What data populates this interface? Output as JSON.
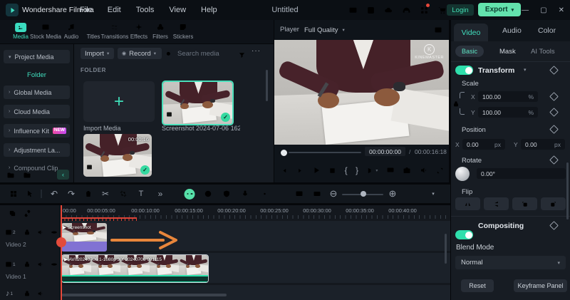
{
  "glyphs": {
    "check": "✓",
    "plus": "+",
    "play": "▶",
    "chevron_down": "▾",
    "chevron_right": "›",
    "chevron_left": "‹",
    "more": "»",
    "ellipsis": "···",
    "undo": "↶",
    "redo": "↷",
    "scissors": "✂",
    "zoom_in_circle": "⊕",
    "zoom_out_circle": "⊖",
    "brace_left": "{",
    "brace_right": "}",
    "minimize": "—",
    "maximize": "▢",
    "close": "✕",
    "record_dot": "◉",
    "text_tool": "T",
    "note": "♪"
  },
  "app": {
    "name": "Wondershare Filmora",
    "menus": [
      "File",
      "Edit",
      "Tools",
      "View",
      "Help"
    ],
    "document_title": "Untitled",
    "login_label": "Login",
    "export_label": "Export"
  },
  "media_tabs": {
    "items": [
      "Media",
      "Stock Media",
      "Audio",
      "Titles",
      "Transitions",
      "Effects",
      "Filters",
      "Stickers"
    ]
  },
  "sidebar": {
    "items": [
      "Project Media",
      "Folder",
      "Global Media",
      "Cloud Media",
      "Influence Kit",
      "Adjustment La...",
      "Compound Clip"
    ],
    "new_badge": "NEW"
  },
  "media_panel": {
    "import_label": "Import",
    "record_label": "Record",
    "search_placeholder": "Search media",
    "section_label": "FOLDER",
    "import_card_label": "Import Media",
    "screenshot_name": "Screenshot 2024-07-06 162...",
    "video_duration": "00:00:16"
  },
  "player": {
    "label": "Player",
    "quality": "Full Quality",
    "watermark_initial": "K",
    "watermark": "KINEMASTER",
    "current_time": "00:00:00:00",
    "time_separator": "/",
    "duration": "00:00:16:18"
  },
  "inspector": {
    "tabs": [
      "Video",
      "Audio",
      "Color"
    ],
    "subtabs": [
      "Basic",
      "Mask",
      "AI Tools"
    ],
    "transform_label": "Transform",
    "scale_label": "Scale",
    "axis_x": "X",
    "axis_y": "Y",
    "scale_x_value": "100.00",
    "scale_y_value": "100.00",
    "percent_unit": "%",
    "position_label": "Position",
    "position_x_value": "0.00",
    "position_y_value": "0.00",
    "px_unit": "px",
    "rotate_label": "Rotate",
    "rotate_value": "0.00°",
    "flip_label": "Flip",
    "compositing_label": "Compositing",
    "blend_mode_label": "Blend Mode",
    "blend_mode_value": "Normal",
    "reset_label": "Reset",
    "keyframe_panel_label": "Keyframe Panel"
  },
  "timeline": {
    "ruler": [
      "00:00",
      "00:00:05:00",
      "00:00:10:00",
      "00:00:15:00",
      "00:00:20:00",
      "00:00:25:00",
      "00:00:30:00",
      "00:00:35:00",
      "00:00:40:00"
    ],
    "video2_label": "Video 2",
    "video2_num": "2",
    "video1_label": "Video 1",
    "video1_num": "1",
    "audio1_num": "1",
    "clip2_name": "Screenshot",
    "clip1_name": "AVI.20240706 1-1080p 30f 20240706 091115"
  }
}
